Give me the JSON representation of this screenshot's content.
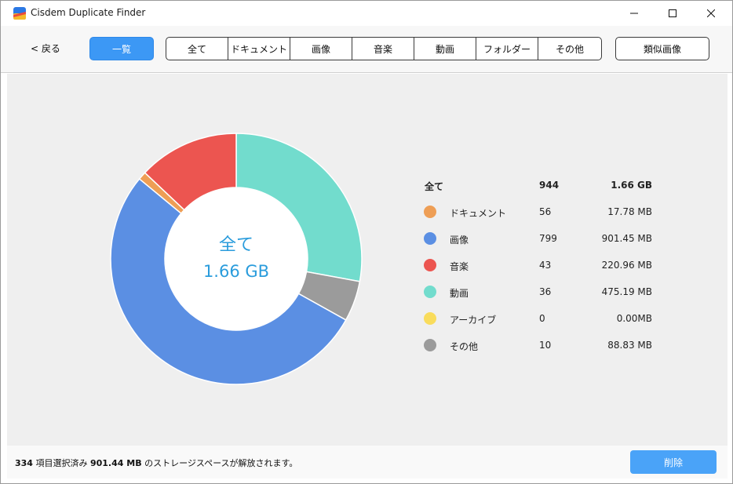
{
  "window": {
    "title": "Cisdem Duplicate Finder"
  },
  "toolbar": {
    "back_label": "< 戻る",
    "overview_label": "一覧",
    "segments": [
      "全て",
      "ドキュメント",
      "画像",
      "音楽",
      "動画",
      "フォルダー",
      "その他"
    ],
    "similar_label": "類似画像"
  },
  "chart": {
    "center_title": "全て",
    "center_size": "1.66 GB"
  },
  "legend": {
    "total": {
      "name": "全て",
      "count": "944",
      "size": "1.66 GB"
    },
    "items": [
      {
        "name": "ドキュメント",
        "count": "56",
        "size": "17.78 MB",
        "color": "#ee9e55"
      },
      {
        "name": "画像",
        "count": "799",
        "size": "901.45 MB",
        "color": "#5b8fe3"
      },
      {
        "name": "音楽",
        "count": "43",
        "size": "220.96 MB",
        "color": "#ec5550"
      },
      {
        "name": "動画",
        "count": "36",
        "size": "475.19 MB",
        "color": "#72dccd"
      },
      {
        "name": "アーカイブ",
        "count": "0",
        "size": "0.00MB",
        "color": "#f9dc5c"
      },
      {
        "name": "その他",
        "count": "10",
        "size": "88.83 MB",
        "color": "#9b9b9b"
      }
    ]
  },
  "chart_data": {
    "type": "pie",
    "title": "全て",
    "donut": true,
    "start": "top",
    "direction": "clockwise",
    "order": [
      "動画",
      "その他",
      "画像",
      "ドキュメント",
      "音楽"
    ],
    "slices": [
      {
        "label": "動画",
        "value": 475.19,
        "unit": "MB",
        "color": "#72dccd"
      },
      {
        "label": "その他",
        "value": 88.83,
        "unit": "MB",
        "color": "#9b9b9b"
      },
      {
        "label": "画像",
        "value": 901.45,
        "unit": "MB",
        "color": "#5b8fe3"
      },
      {
        "label": "ドキュメント",
        "value": 17.78,
        "unit": "MB",
        "color": "#ee9e55"
      },
      {
        "label": "音楽",
        "value": 220.96,
        "unit": "MB",
        "color": "#ec5550"
      }
    ]
  },
  "footer": {
    "count": "334",
    "selected_text": "項目選択済み",
    "size": "901.44 MB",
    "space_text": "のストレージスペースが解放されます。",
    "delete_label": "削除"
  }
}
